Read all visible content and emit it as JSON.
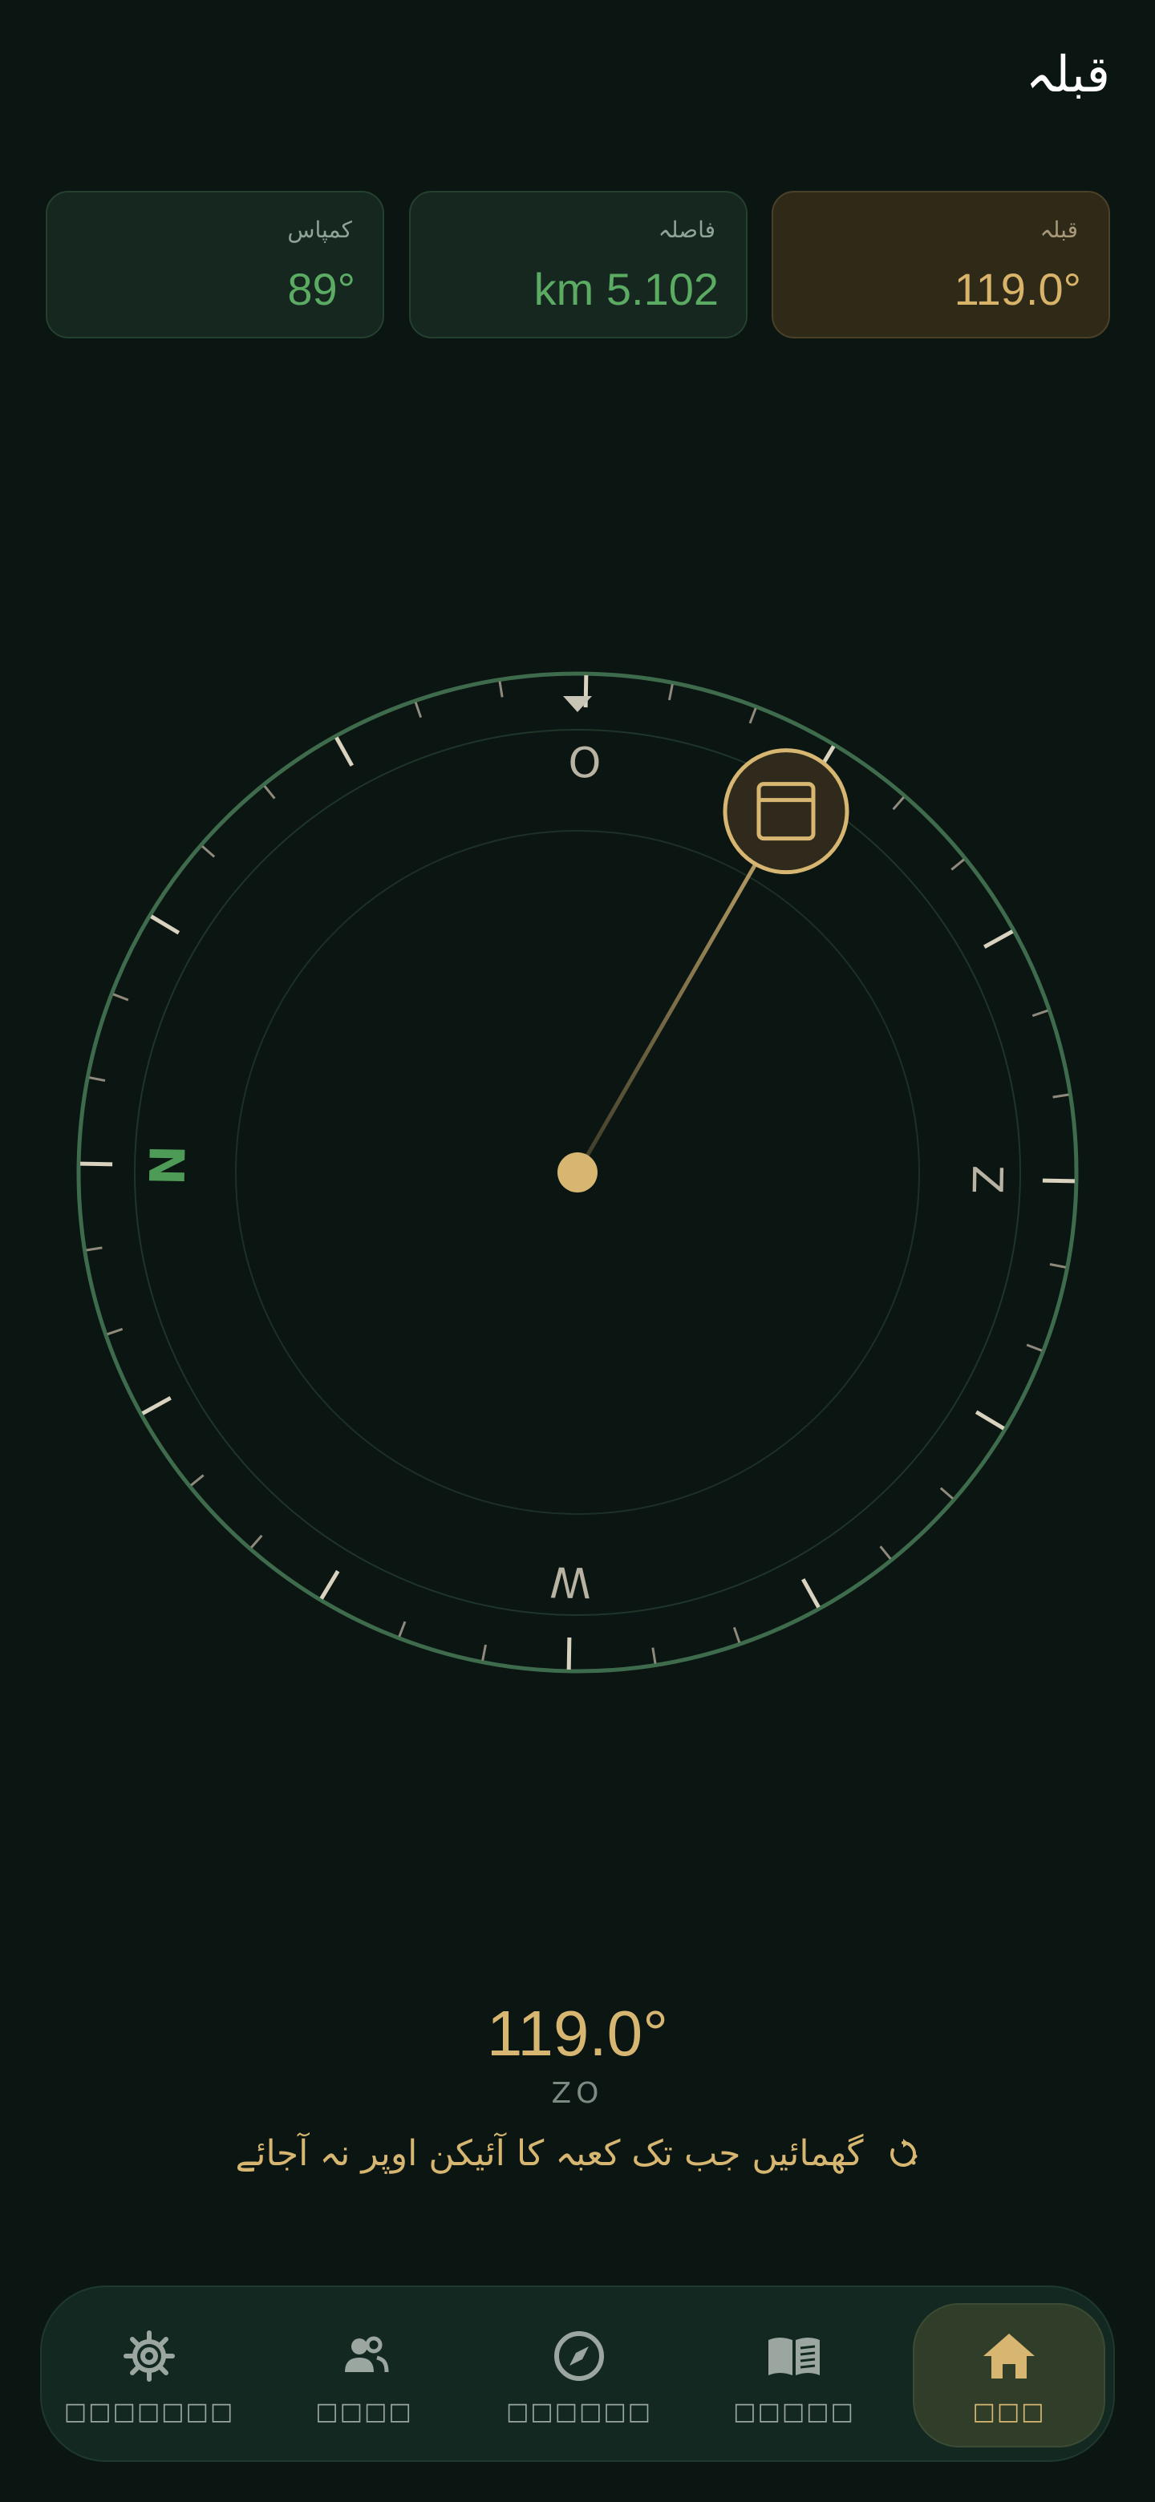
{
  "header": {
    "title": "قبلہ"
  },
  "stats": [
    {
      "label": "قبلہ",
      "value": "119.0°",
      "active": true
    },
    {
      "label": "فاصلہ",
      "value": "km 5.102",
      "active": false
    },
    {
      "label": "کمپاس",
      "value": "89°",
      "active": false
    }
  ],
  "compass": {
    "heading_deg": 89,
    "qibla_deg": 119.0,
    "cardinals": {
      "north": "N",
      "east": "O",
      "south": "Z",
      "west": "W"
    },
    "qibla_icon": "kaaba-icon",
    "colors": {
      "ring": "#3f6b4d",
      "accent": "#d7b671",
      "north": "#4e9b57"
    }
  },
  "readout": {
    "heading": "119.0°",
    "direction": "ZO",
    "hint": "گھمائیں جب تک کعبہ کا آئیکن اوپر نہ آجائے",
    "hint_icon": "rotate-icon"
  },
  "nav": [
    {
      "label": "□□□□□□□",
      "icon": "settings-icon"
    },
    {
      "label": "□□□□",
      "icon": "people-icon"
    },
    {
      "label": "□□□□□□",
      "icon": "compass-icon"
    },
    {
      "label": "□□□□□",
      "icon": "book-icon"
    },
    {
      "label": "□□□",
      "icon": "home-icon",
      "active": true
    }
  ]
}
